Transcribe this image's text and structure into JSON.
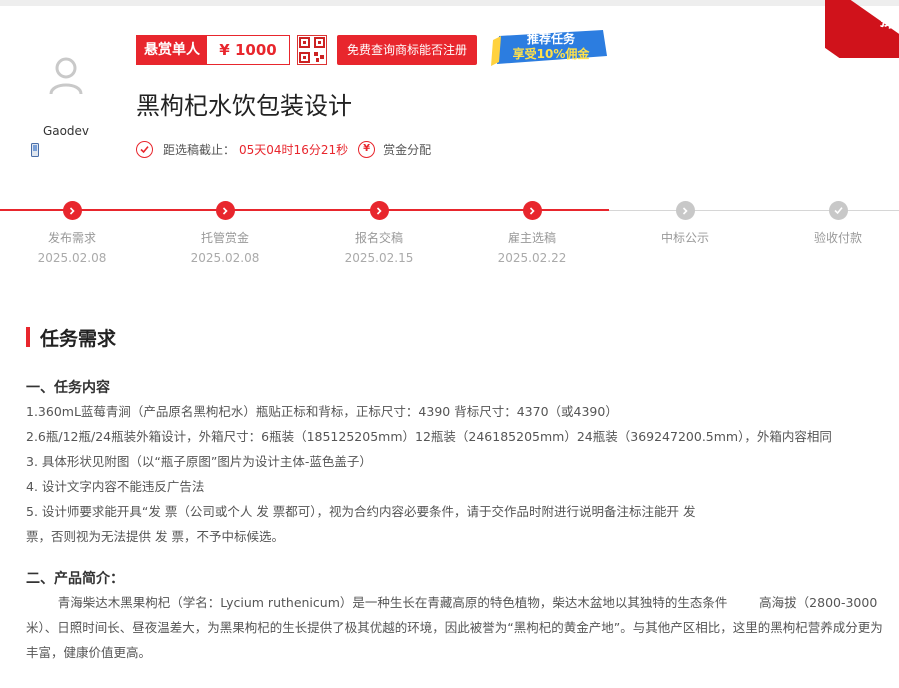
{
  "user": {
    "name": "Gaodev"
  },
  "ribbon": {
    "text": "探"
  },
  "reward": {
    "label": "悬赏单人",
    "amount": "¥ 1000"
  },
  "check_button": "免费查询商标能否注册",
  "promo": {
    "line1": "推荐任务",
    "line2": "享受10%佣金"
  },
  "task": {
    "title": "黑枸杞水饮包装设计"
  },
  "deadline": {
    "label": "距选稿截止：",
    "time": "05天04时16分21秒",
    "split": "赏金分配"
  },
  "steps": [
    {
      "label": "发布需求",
      "date": "2025.02.08"
    },
    {
      "label": "托管赏金",
      "date": "2025.02.08"
    },
    {
      "label": "报名交稿",
      "date": "2025.02.15"
    },
    {
      "label": "雇主选稿",
      "date": "2025.02.22"
    },
    {
      "label": "中标公示",
      "date": ""
    },
    {
      "label": "验收付款",
      "date": ""
    }
  ],
  "section": {
    "title": "任务需求"
  },
  "content": {
    "h1": "一、任务内容",
    "items": [
      "1.360mL蓝莓青涧（产品原名黑枸杞水）瓶贴正标和背标，正标尺寸：4390  背标尺寸：4370（或4390）",
      "2.6瓶/12瓶/24瓶装外箱设计，外箱尺寸：6瓶装（185125205mm）12瓶装（246185205mm）24瓶装（369247200.5mm），外箱内容相同",
      "3.    具体形状见附图（以“瓶子原图”图片为设计主体-蓝色盖子）",
      "4.    设计文字内容不能违反广告法",
      "5.    设计师要求能开具“发    票（公司或个人    发    票都可），视为合约内容必要条件，请于交作品时附进行说明备注标注能开    发",
      "票，否则视为无法提供    发    票，不予中标候选。"
    ],
    "h2": "二、产品简介：",
    "intro": "        青海柴达木黑果枸杞（学名：Lycium ruthenicum）是一种生长在青藏高原的特色植物，柴达木盆地以其独特的生态条件        高海拔（2800-3000米）、日照时间长、昼夜温差大，为黑果枸杞的生长提供了极其优越的环境，因此被誉为“黑枸杞的黄金产地”。与其他产区相比，这里的黑枸杞营养成分更为丰富，健康价值更高。"
  }
}
